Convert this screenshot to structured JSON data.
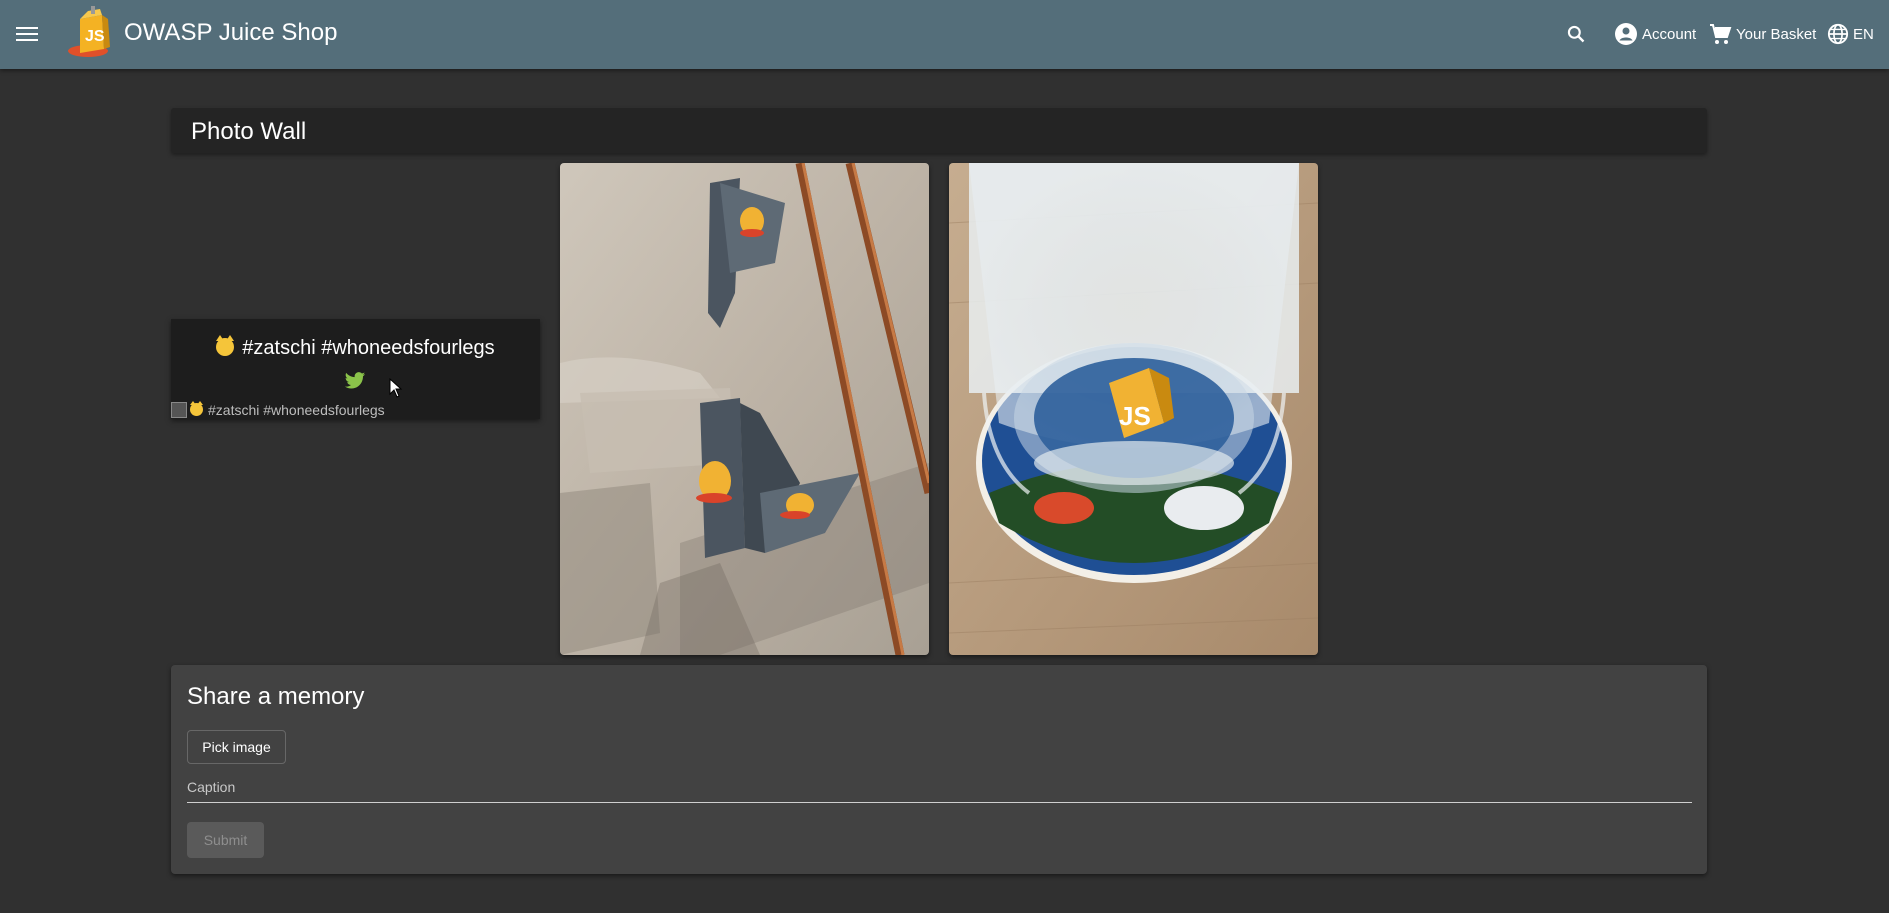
{
  "header": {
    "title": "OWASP Juice Shop",
    "menu_icon": "menu-icon",
    "search_icon": "search-icon",
    "account_label": "Account",
    "basket_label": "Your Basket",
    "language_label": "EN",
    "bg_color": "#546e7a"
  },
  "page": {
    "title": "Photo Wall",
    "bg_color": "#303030"
  },
  "photos": [
    {
      "caption": "#zatschi #whoneedsfourlegs",
      "emoji": "cat-face",
      "alt_text": "#zatschi #whoneedsfourlegs",
      "twitter_icon": "twitter-icon",
      "status": "broken-image"
    },
    {
      "description_icon": "photo-wall-brackets-with-juice-shop-stickers"
    },
    {
      "description_icon": "photo-glass-on-juice-shop-coaster"
    }
  ],
  "share": {
    "title": "Share a memory",
    "pick_image_label": "Pick image",
    "caption_label": "Caption",
    "submit_label": "Submit"
  }
}
